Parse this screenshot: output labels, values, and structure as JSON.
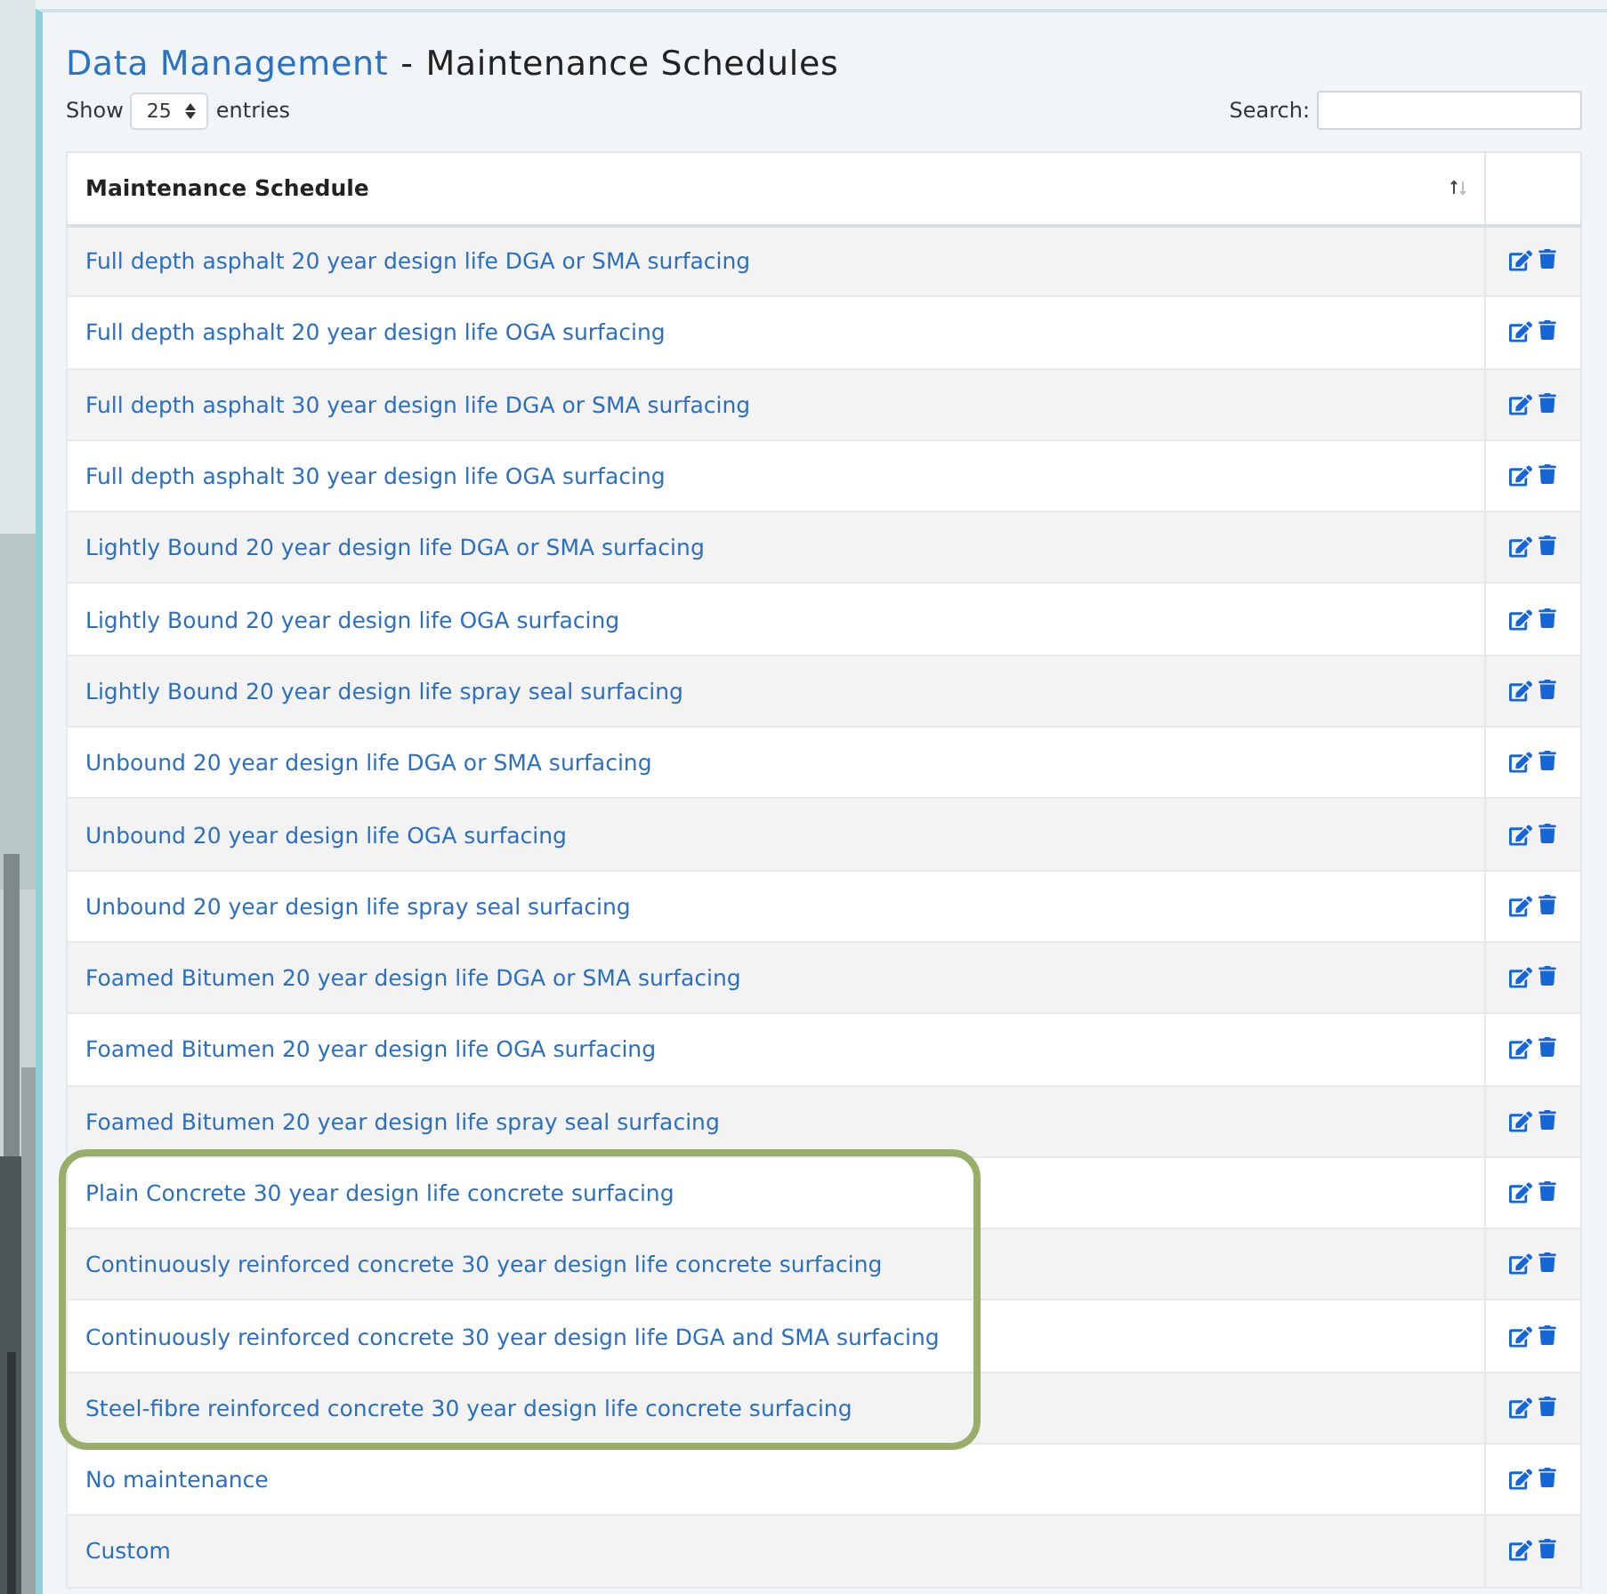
{
  "header": {
    "section": "Data Management",
    "separator": "-",
    "title": "Maintenance Schedules"
  },
  "length_control": {
    "prefix": "Show",
    "value": "25",
    "suffix": "entries"
  },
  "search": {
    "label": "Search:"
  },
  "table": {
    "columns": [
      {
        "label": "Maintenance Schedule",
        "sortable": true
      }
    ],
    "rows": [
      {
        "name": "Full depth asphalt 20 year design life DGA or SMA surfacing",
        "highlighted": false
      },
      {
        "name": "Full depth asphalt 20 year design life OGA surfacing",
        "highlighted": false
      },
      {
        "name": "Full depth asphalt 30 year design life DGA or SMA surfacing",
        "highlighted": false
      },
      {
        "name": "Full depth asphalt 30 year design life OGA surfacing",
        "highlighted": false
      },
      {
        "name": "Lightly Bound 20 year design life DGA or SMA surfacing",
        "highlighted": false
      },
      {
        "name": "Lightly Bound 20 year design life OGA surfacing",
        "highlighted": false
      },
      {
        "name": "Lightly Bound 20 year design life spray seal surfacing",
        "highlighted": false
      },
      {
        "name": "Unbound 20 year design life DGA or SMA surfacing",
        "highlighted": false
      },
      {
        "name": "Unbound 20 year design life OGA surfacing",
        "highlighted": false
      },
      {
        "name": "Unbound 20 year design life spray seal surfacing",
        "highlighted": false
      },
      {
        "name": "Foamed Bitumen 20 year design life DGA or SMA surfacing",
        "highlighted": false
      },
      {
        "name": "Foamed Bitumen 20 year design life OGA surfacing",
        "highlighted": false
      },
      {
        "name": "Foamed Bitumen 20 year design life spray seal surfacing",
        "highlighted": false
      },
      {
        "name": "Plain Concrete 30 year design life concrete surfacing",
        "highlighted": true
      },
      {
        "name": "Continuously reinforced concrete 30 year design life concrete surfacing",
        "highlighted": true
      },
      {
        "name": "Continuously reinforced concrete 30 year design life DGA and SMA surfacing",
        "highlighted": true
      },
      {
        "name": "Steel-fibre reinforced concrete 30 year design life concrete surfacing",
        "highlighted": true
      },
      {
        "name": "No maintenance",
        "highlighted": false
      },
      {
        "name": "Custom",
        "highlighted": false
      }
    ]
  }
}
